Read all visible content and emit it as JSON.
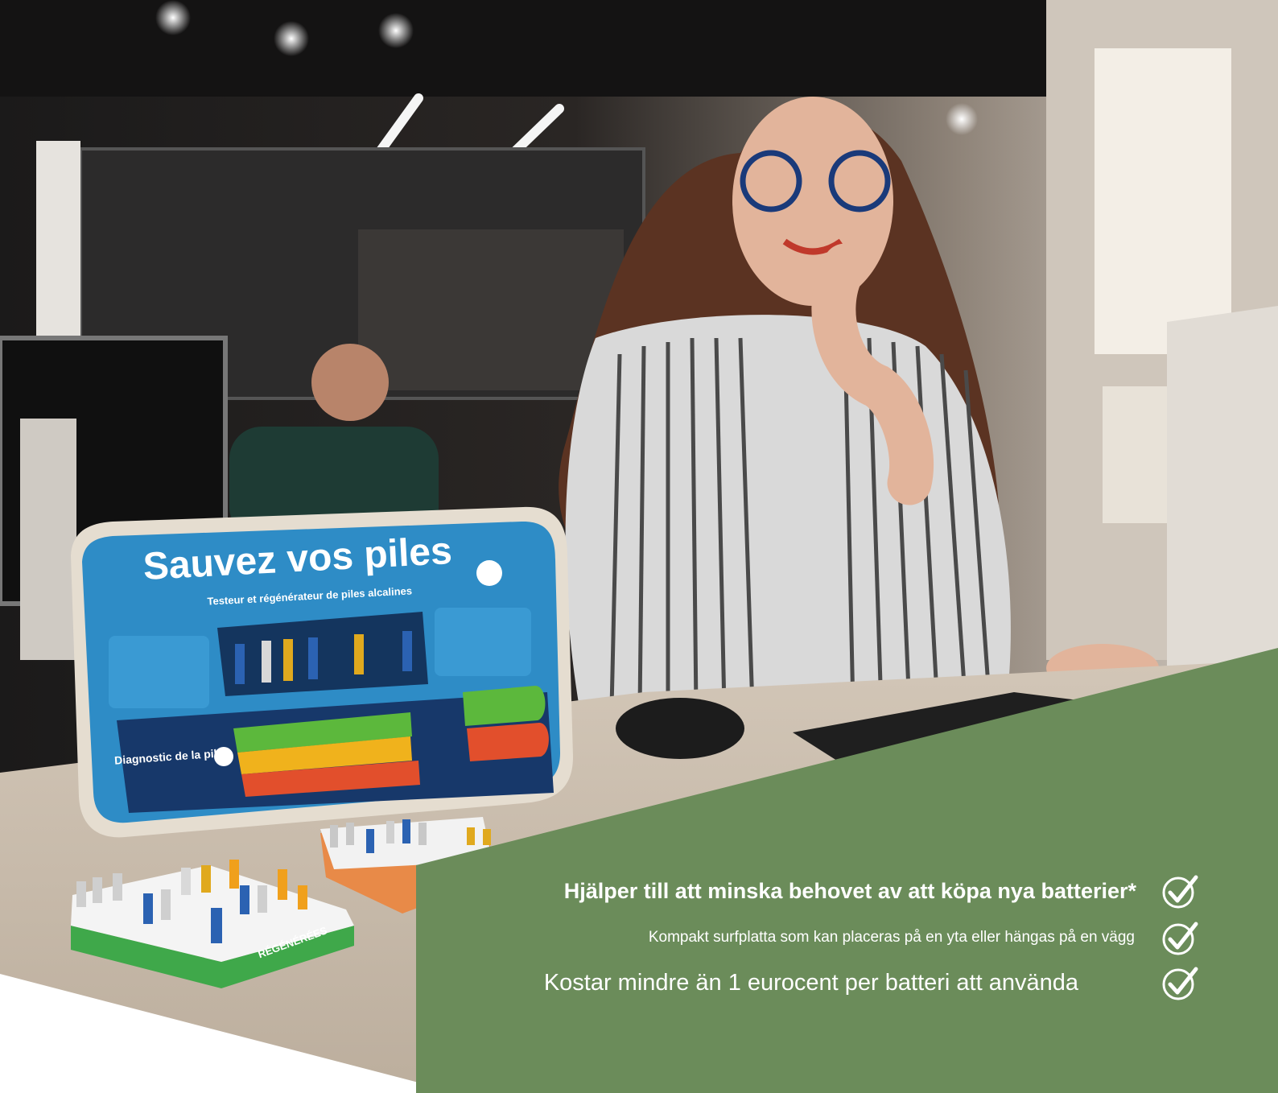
{
  "scene": {
    "device_title": "Sauvez vos piles",
    "device_subtitle": "Testeur et régénérateur de piles alcalines",
    "diagnostic_label": "Diagnostic de la pile",
    "tray_label": "RÉGÉNÉRÉES"
  },
  "features": [
    {
      "text": "Hjälper till att minska behovet av att köpa nya batterier*"
    },
    {
      "text": "Kompakt surfplatta som kan placeras på en yta eller hängas på en vägg"
    },
    {
      "text": "Kostar mindre än 1 eurocent per batteri att använda"
    }
  ],
  "colors": {
    "panel": "#6b8c5a",
    "check": "#ffffff"
  },
  "icons": [
    "check-icon",
    "check-icon",
    "check-icon"
  ]
}
